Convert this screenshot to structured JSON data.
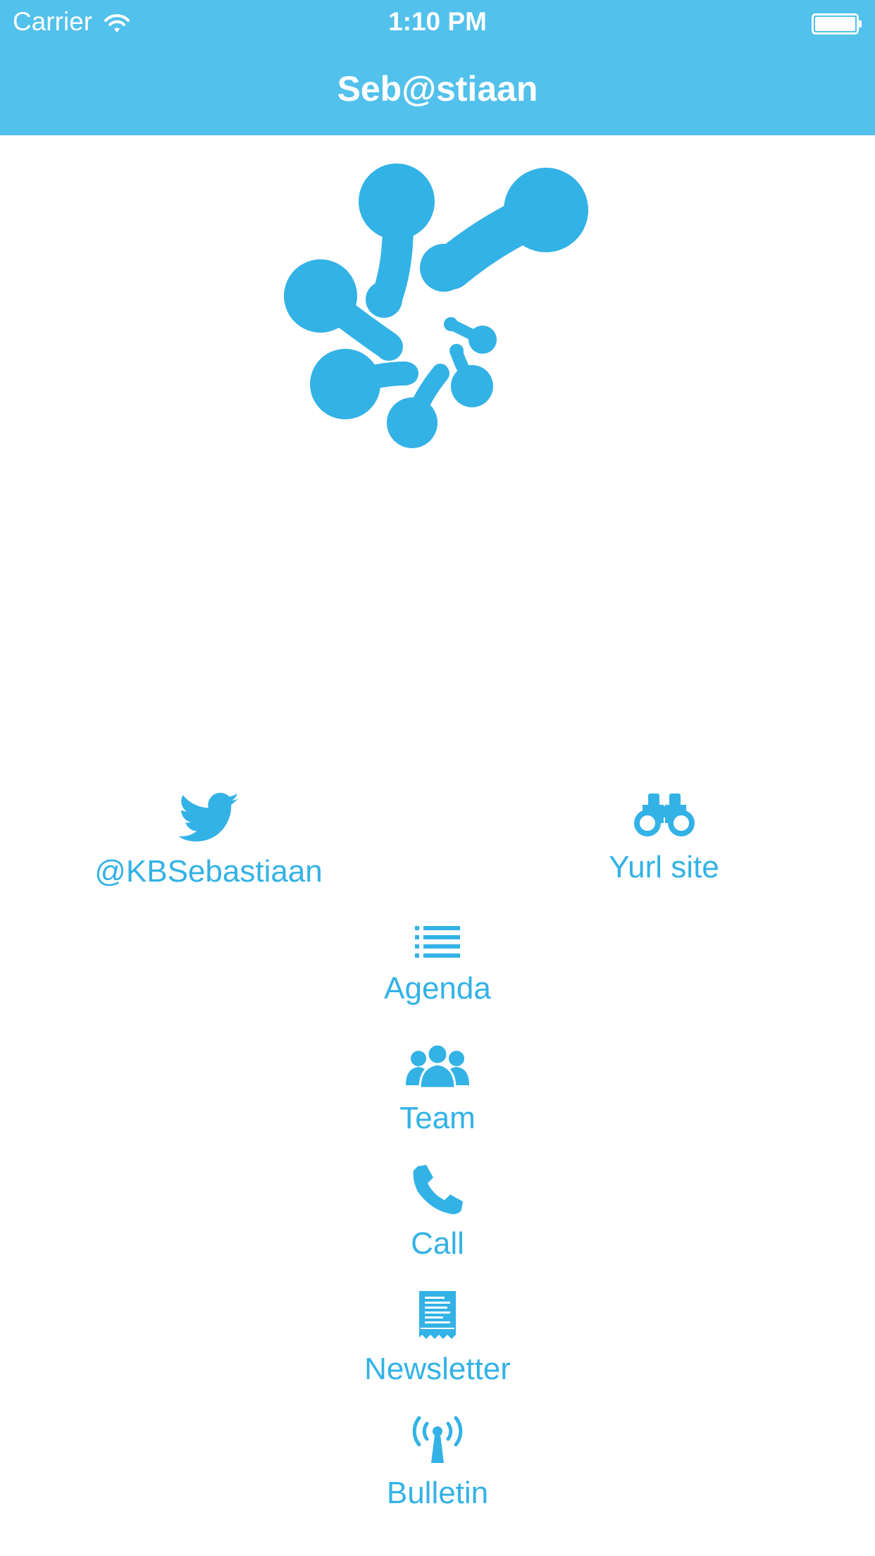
{
  "status_bar": {
    "carrier": "Carrier",
    "time": "1:10 PM"
  },
  "nav": {
    "title": "Seb@stiaan"
  },
  "colors": {
    "nav_bar": "#52c1eb",
    "accent": "#33b2e6",
    "background": "#ffffff"
  },
  "logo": {
    "icon": "blob-molecule-logo"
  },
  "actions": {
    "twitter": {
      "label": "@KBSebastiaan",
      "icon": "twitter-bird-icon"
    },
    "website": {
      "label": "Yurl site",
      "icon": "binoculars-icon"
    },
    "agenda": {
      "label": "Agenda",
      "icon": "list-icon"
    },
    "team": {
      "label": "Team",
      "icon": "people-icon"
    },
    "call": {
      "label": "Call",
      "icon": "phone-icon"
    },
    "newsletter": {
      "label": "Newsletter",
      "icon": "receipt-icon"
    },
    "bulletin": {
      "label": "Bulletin",
      "icon": "antenna-icon"
    }
  }
}
